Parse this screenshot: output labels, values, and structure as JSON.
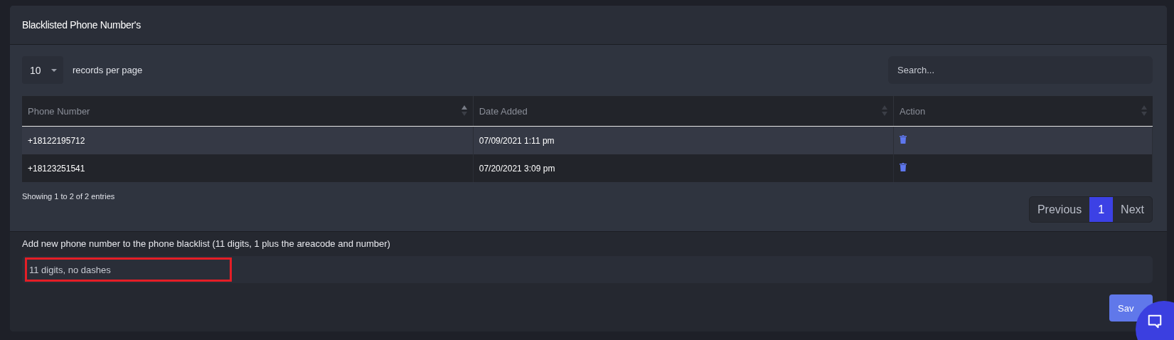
{
  "card": {
    "title": "Blacklisted Phone Number's"
  },
  "length_menu": {
    "value": "10",
    "label": "records per page"
  },
  "search": {
    "placeholder": "Search..."
  },
  "table": {
    "columns": [
      {
        "label": "Phone Number",
        "sorted": true
      },
      {
        "label": "Date Added",
        "sorted": false
      },
      {
        "label": "Action",
        "sorted": false
      }
    ],
    "rows": [
      {
        "phone": "+18122195712",
        "date": "07/09/2021 1:11 pm"
      },
      {
        "phone": "+18123251541",
        "date": "07/20/2021 3:09 pm"
      }
    ]
  },
  "info": "Showing 1 to 2 of 2 entries",
  "pagination": [
    {
      "label": "Previous",
      "selected": false
    },
    {
      "label": "1",
      "selected": true
    },
    {
      "label": "Next",
      "selected": false
    }
  ],
  "add_form": {
    "label": "Add new phone number to the phone blacklist (11 digits, 1 plus the areacode and number)",
    "placeholder": "11 digits, no dashes",
    "highlighted": true
  },
  "save_button": "Sav"
}
